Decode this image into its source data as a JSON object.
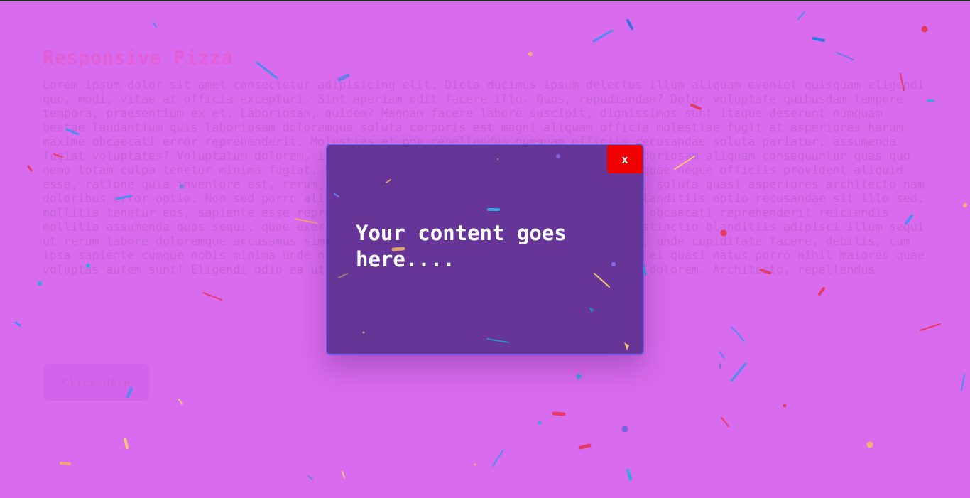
{
  "page": {
    "title": "Responsive Pizza",
    "body_text": "Lorem ipsum dolor sit amet consectetur adipisicing elit. Dicta ducimus ipsum delectus illum aliquam eveniet quisquam eligendi quo, modi, vitae at officia excepturi. Sint aperiam odit facere illo. Quos, repudiandae? Dolor voluptate quibusdam tempore tempora, praesentium ex et. Laboriosam, quidem? Magnam facere labore suscipit, dignissimos sunt itaque deserunt numquam beatae laudantium quis laboriosam doloremque soluta corporis est magni aliquam officia molestiae fugit at asperiores harum maxime obcaecati error reprehenderit. Molestias et non repellendus numquam officiis recusandae soluta pariatur, assumenda fugiat voluptates? Voluptatum dolorem, illum officiis eveniet rerum ducimus in hic laboriosam aliquam consequuntur quas quo nemo totam culpa tenetur minima fugiat. Harum, nam distinctio! Itaque repellendus in quae neque officiis provident aliquid esse, ratione quia inventore est, rerum, tempore libero asso praesentium facilis quos, soluta quasi asperiores architecto nam doloribus error optio. Non sed porro aliquid, facere illum officiis eveniet magnam, blanditiis optio recusandae sit illo sed, mollitia tenetur eos, sapiente esse reprehenderit iure possimus placeat eveniet fugit obcaecati reprehenderit reiciendis mollitia assumenda quos sequi, quae exercitationem blanditiis unde? Necessitatibus distinctio blanditiis adipisci illum sequi ut rerum labore doloremque accusamus similique tem dolor. In, omnis voluptatum. Animi, unde cupiditate facere, debitis, cum ipsa sapiente cumque nobis minima unde numquam reiciendis nemo sint beatae voluptatem ei quasi natus porro nihil maiores quae voluptas autem sunt! Eligendi odio ea ut natur eum reprehenderit corrupti, a suscipit dolorem. Architecto, repellendus",
    "button_label": "Click Here"
  },
  "modal": {
    "content": "Your content goes here....",
    "close_label": "x"
  },
  "colors": {
    "page_background": "#d96bee",
    "modal_background": "#673597",
    "modal_border": "#6a59e0",
    "close_button": "#f00000"
  }
}
